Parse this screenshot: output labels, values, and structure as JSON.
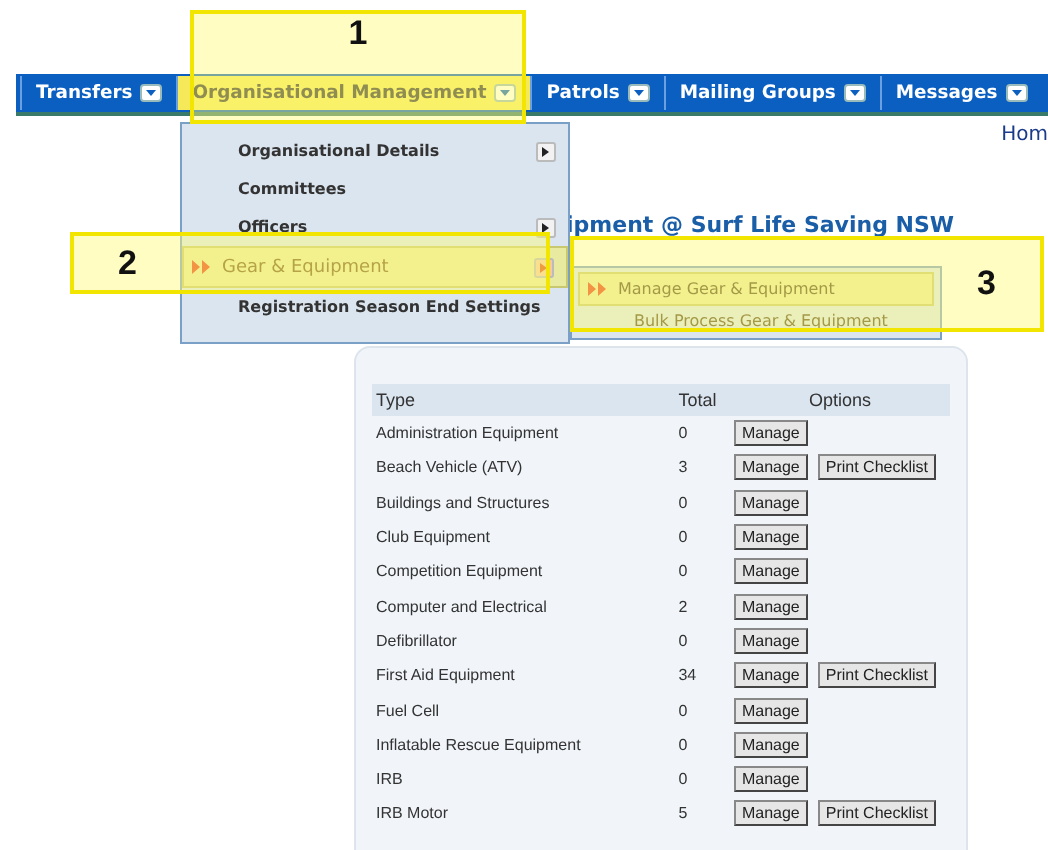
{
  "nav": {
    "items": [
      {
        "label": "Transfers",
        "selected": false
      },
      {
        "label": "Organisational Management",
        "selected": true
      },
      {
        "label": "Patrols",
        "selected": false
      },
      {
        "label": "Mailing Groups",
        "selected": false
      },
      {
        "label": "Messages",
        "selected": false
      }
    ]
  },
  "home_link": "Hom",
  "heading": "ipment @ Surf Life Saving NSW",
  "menu": {
    "items": [
      {
        "label": "Organisational Details",
        "selected": false,
        "submenu": true
      },
      {
        "label": "Committees",
        "selected": false,
        "submenu": false
      },
      {
        "label": "Officers",
        "selected": false,
        "submenu": true
      },
      {
        "label": "Gear & Equipment",
        "selected": true,
        "submenu": true
      },
      {
        "label": "Registration Season End Settings",
        "selected": false,
        "submenu": false
      }
    ]
  },
  "submenu": {
    "items": [
      {
        "label": "Manage Gear & Equipment",
        "selected": true
      },
      {
        "label": "Bulk Process Gear & Equipment",
        "selected": false
      }
    ]
  },
  "table": {
    "columns": [
      "Type",
      "Total",
      "Options"
    ],
    "rows": [
      {
        "type": "Administration Equipment",
        "total": "0",
        "buttons": [
          "Manage"
        ]
      },
      {
        "type": "Beach Vehicle (ATV)",
        "total": "3",
        "buttons": [
          "Manage",
          "Print Checklist"
        ]
      },
      {
        "type": "Buildings and Structures",
        "total": "0",
        "buttons": [
          "Manage"
        ]
      },
      {
        "type": "Club Equipment",
        "total": "0",
        "buttons": [
          "Manage"
        ]
      },
      {
        "type": "Competition Equipment",
        "total": "0",
        "buttons": [
          "Manage"
        ]
      },
      {
        "type": "Computer and Electrical",
        "total": "2",
        "buttons": [
          "Manage"
        ]
      },
      {
        "type": "Defibrillator",
        "total": "0",
        "buttons": [
          "Manage"
        ]
      },
      {
        "type": "First Aid Equipment",
        "total": "34",
        "buttons": [
          "Manage",
          "Print Checklist"
        ]
      },
      {
        "type": "Fuel Cell",
        "total": "0",
        "buttons": [
          "Manage"
        ]
      },
      {
        "type": "Inflatable Rescue Equipment",
        "total": "0",
        "buttons": [
          "Manage"
        ]
      },
      {
        "type": "IRB",
        "total": "0",
        "buttons": [
          "Manage"
        ]
      },
      {
        "type": "IRB Motor",
        "total": "5",
        "buttons": [
          "Manage",
          "Print Checklist"
        ]
      }
    ]
  },
  "callouts": [
    {
      "number": "1"
    },
    {
      "number": "2"
    },
    {
      "number": "3"
    }
  ]
}
